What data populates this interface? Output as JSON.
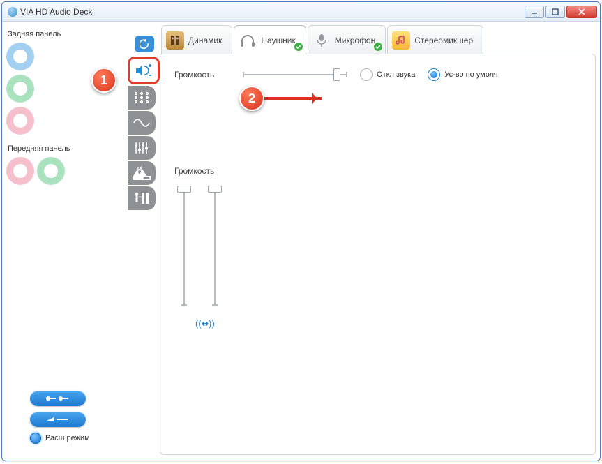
{
  "window": {
    "title": "VIA HD Audio Deck"
  },
  "sidebar": {
    "rear_label": "Задняя панель",
    "front_label": "Передняя панель",
    "mode_label": "Расш режим"
  },
  "tabs": {
    "speaker": "Динамик",
    "headphone": "Наушник",
    "mic": "Микрофон",
    "stereomix": "Стереомикшер"
  },
  "content": {
    "volume_label": "Громкость",
    "mute_label": "Откл звука",
    "default_label": "Ус-во по умолч",
    "main_slider_pct": 90,
    "channel_left_pct": 2,
    "channel_right_pct": 2
  },
  "annotations": {
    "step1": "1",
    "step2": "2"
  },
  "icons": {
    "back": "back-icon",
    "volume": "volume-plus-icon",
    "matrix": "matrix-icon",
    "wave": "sine-icon",
    "eq": "equalizer-icon",
    "scene": "scene-icon",
    "room": "room-icon",
    "connector": "connector-icon",
    "info": "info-icon",
    "link": "link-channels-icon"
  }
}
